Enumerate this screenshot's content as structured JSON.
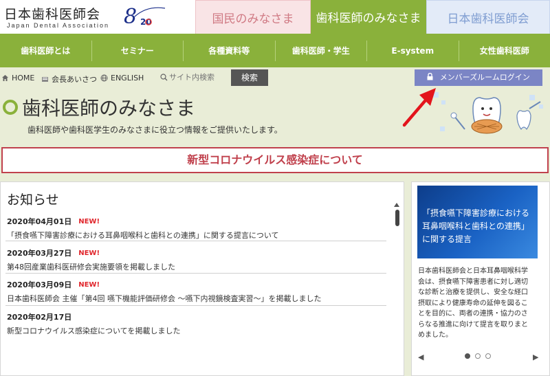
{
  "header": {
    "logo_jp": "日本歯科医師会",
    "logo_en": "Japan Dental Association",
    "logo_mark": "8020",
    "tabs": [
      {
        "label": "国民のみなさま"
      },
      {
        "label": "歯科医師のみなさま"
      },
      {
        "label": "日本歯科医師会"
      }
    ]
  },
  "nav": {
    "items": [
      {
        "label": "歯科医師とは"
      },
      {
        "label": "セミナー"
      },
      {
        "label": "各種資料等"
      },
      {
        "label": "歯科医師・学生"
      },
      {
        "label": "E-system"
      },
      {
        "label": "女性歯科医師"
      }
    ]
  },
  "util": {
    "home": "HOME",
    "greeting": "会長あいさつ",
    "english": "ENGLISH",
    "search_placeholder": "サイト内検索",
    "search_button": "検索",
    "member_login": "メンバーズルームログイン"
  },
  "hero": {
    "title": "歯科医師のみなさま",
    "subtitle": "歯科医師や歯科医学生のみなさまに役立つ情報をご提供いたします。"
  },
  "covid_banner": "新型コロナウイルス感染症について",
  "news": {
    "title": "お知らせ",
    "items": [
      {
        "date": "2020年04月01日",
        "new": "NEW!",
        "text": "「摂食嚥下障害診療における耳鼻咽喉科と歯科との連携」に関する提言について"
      },
      {
        "date": "2020年03月27日",
        "new": "NEW!",
        "text": "第48回産業歯科医研修会実施要領を掲載しました"
      },
      {
        "date": "2020年03月09日",
        "new": "NEW!",
        "text": "日本歯科医師会 主催「第4回 嚥下機能評価研修会 ～嚥下内視鏡検査実習～」を掲載しました"
      },
      {
        "date": "2020年02月17日",
        "new": "",
        "text": "新型コロナウイルス感染症についてを掲載しました"
      }
    ]
  },
  "card": {
    "image_lines": [
      "「摂食嚥下障害診療における",
      "耳鼻咽喉科と歯科との連携」",
      "に関する提言"
    ],
    "body_lines": [
      "日本歯科医師会と日本耳鼻咽喉科学",
      "会は、摂食嚥下障害患者に対し適切",
      "な診断と治療を提供し、安全な経口",
      "摂取により健康寿命の延伸を図るこ",
      "とを目的に、両者の連携・協力のさ",
      "らなる推進に向けて提言を取りまと",
      "めました。"
    ],
    "prev": "◀",
    "next": "▶"
  },
  "icons": {
    "home": "home-icon",
    "greeting": "person-icon",
    "english": "globe-icon",
    "search": "search-icon",
    "lock": "lock-icon"
  },
  "colors": {
    "brand_green": "#8ab13b",
    "covid_red": "#c0404c",
    "new_red": "#e0252b",
    "member_blue": "#7b85c5"
  }
}
